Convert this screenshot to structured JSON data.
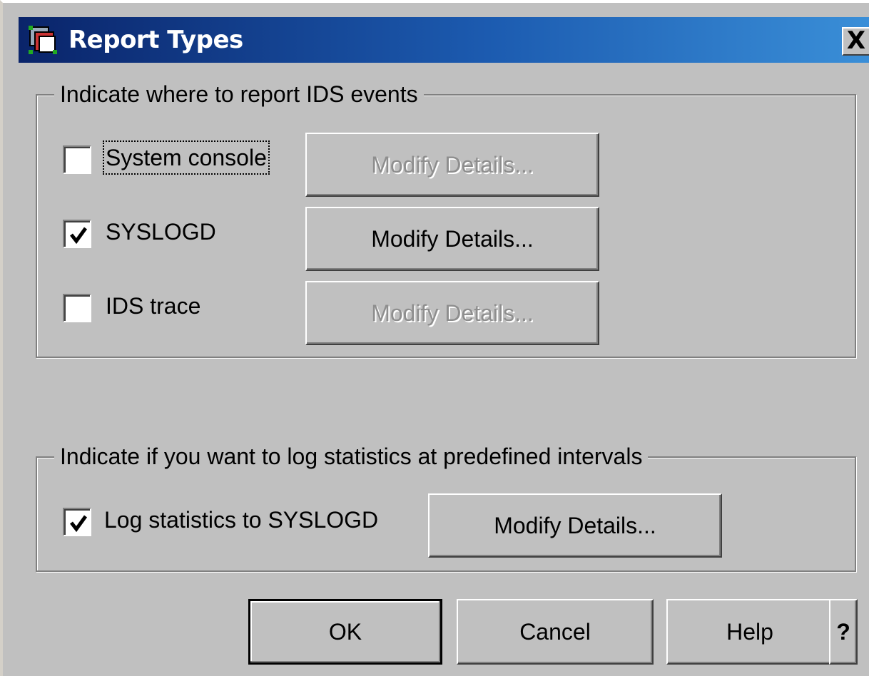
{
  "window": {
    "title": "Report Types",
    "close_glyph": "X"
  },
  "group_events": {
    "label": "Indicate where to report IDS events",
    "rows": [
      {
        "label": "System console",
        "checked": false,
        "button": "Modify Details...",
        "button_enabled": false
      },
      {
        "label": "SYSLOGD",
        "checked": true,
        "button": "Modify Details...",
        "button_enabled": true
      },
      {
        "label": "IDS trace",
        "checked": false,
        "button": "Modify Details...",
        "button_enabled": false
      }
    ]
  },
  "group_stats": {
    "label": "Indicate if you want to log statistics at predefined intervals",
    "row": {
      "label": "Log statistics to SYSLOGD",
      "checked": true,
      "button": "Modify Details..."
    }
  },
  "footer": {
    "ok": "OK",
    "cancel": "Cancel",
    "help": "Help",
    "whats_this": "?"
  },
  "icons": {
    "title": "report-window-icon",
    "close": "close-icon",
    "check": "checkmark-icon"
  }
}
